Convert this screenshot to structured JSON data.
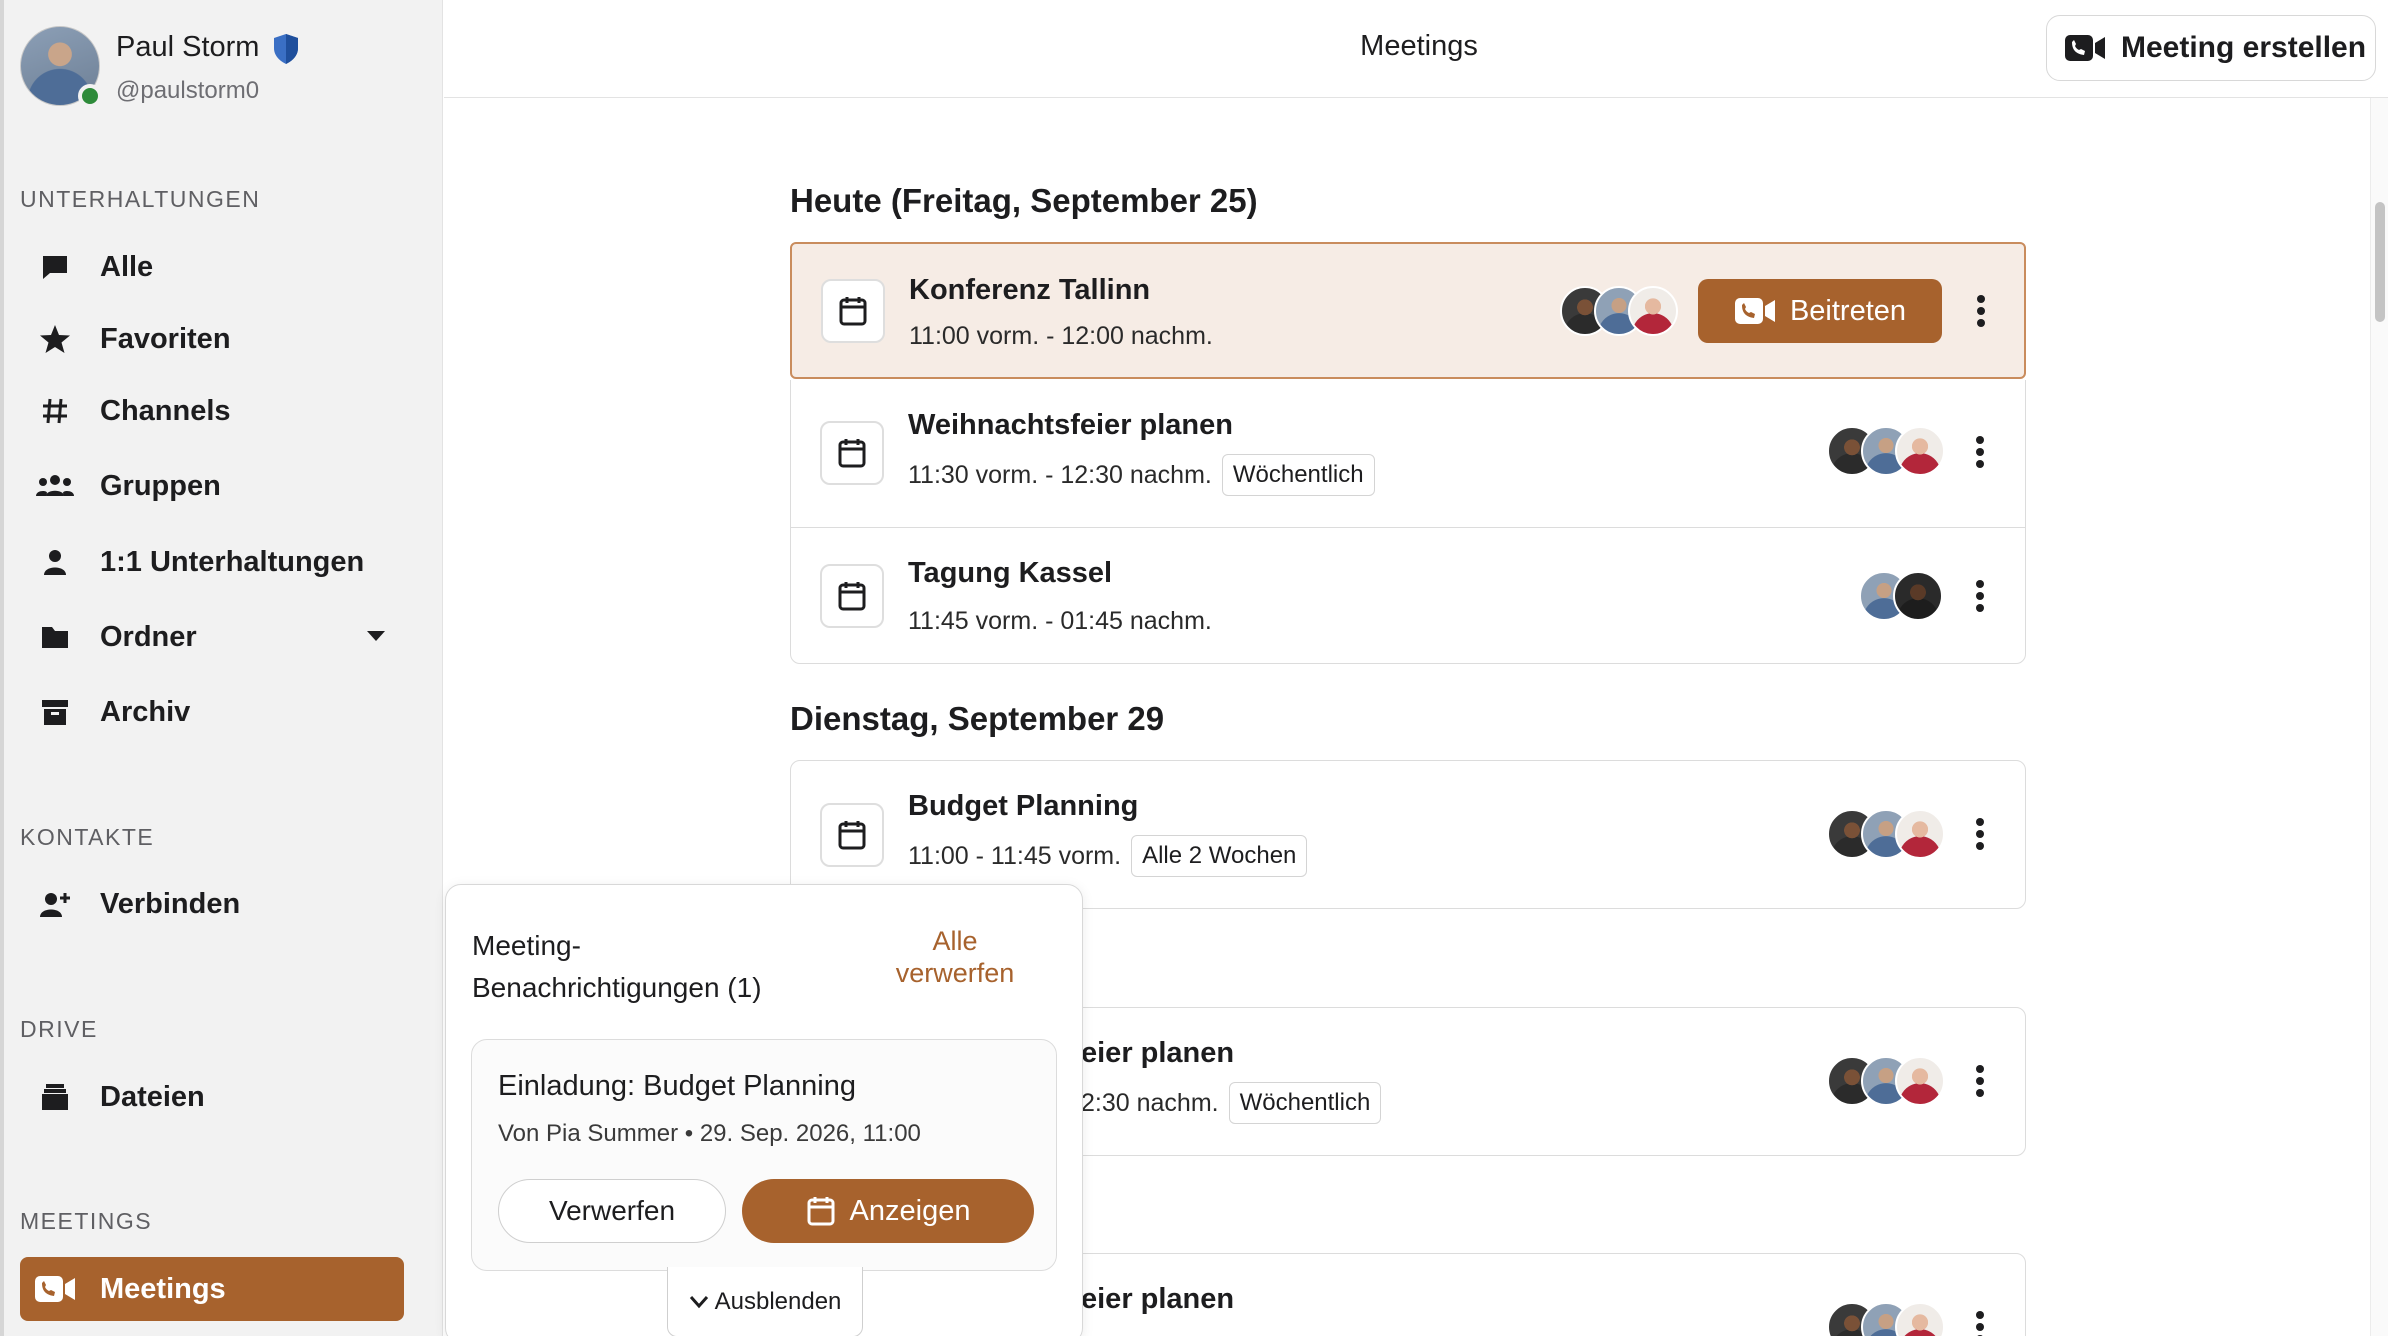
{
  "user": {
    "name": "Paul Storm",
    "handle": "@paulstorm0",
    "status": "online"
  },
  "sidebar": {
    "sections": {
      "conversations": "UNTERHALTUNGEN",
      "contacts": "KONTAKTE",
      "drive": "DRIVE",
      "meetings": "MEETINGS"
    },
    "items": [
      {
        "label": "Alle",
        "icon": "chat-bubble-icon"
      },
      {
        "label": "Favoriten",
        "icon": "star-icon"
      },
      {
        "label": "Channels",
        "icon": "hash-icon"
      },
      {
        "label": "Gruppen",
        "icon": "group-icon"
      },
      {
        "label": "1:1 Unterhaltungen",
        "icon": "person-icon"
      },
      {
        "label": "Ordner",
        "icon": "folder-icon"
      },
      {
        "label": "Archiv",
        "icon": "archive-icon"
      },
      {
        "label": "Verbinden",
        "icon": "add-person-icon"
      },
      {
        "label": "Dateien",
        "icon": "files-icon"
      },
      {
        "label": "Meetings",
        "icon": "video-call-icon",
        "active": true
      }
    ]
  },
  "header": {
    "title": "Meetings",
    "create_label": "Meeting erstellen"
  },
  "days": [
    {
      "heading": "Heute (Freitag, September 25)",
      "meetings": [
        {
          "title": "Konferenz Tallinn",
          "time": "11:00 vorm. - 12:00 nachm.",
          "recurrence": "",
          "join_label": "Beitreten",
          "highlight": true
        },
        {
          "title": "Weihnachtsfeier planen",
          "time": "11:30 vorm. - 12:30 nachm.",
          "recurrence": "Wöchentlich"
        },
        {
          "title": "Tagung Kassel",
          "time": "11:45 vorm. - 01:45 nachm.",
          "recurrence": ""
        }
      ]
    },
    {
      "heading": "Dienstag, September 29",
      "meetings": [
        {
          "title": "Budget Planning",
          "time": "11:00 - 11:45 vorm.",
          "recurrence": "Alle 2 Wochen"
        },
        {
          "title": "eier planen",
          "time": "2:30 nachm.",
          "recurrence": "Wöchentlich"
        },
        {
          "title": "eier planen",
          "time": "",
          "recurrence": ""
        }
      ]
    }
  ],
  "notifications": {
    "title": "Meeting-Benachrichtigungen (1)",
    "title_line1": "Meeting-",
    "title_line2": "Benachrichtigungen (1)",
    "dismiss_all_line1": "Alle",
    "dismiss_all_line2": "verwerfen",
    "invite": {
      "title": "Einladung: Budget Planning",
      "subtitle": "Von Pia Summer • 29. Sep. 2026, 11:00",
      "reject_label": "Verwerfen",
      "view_label": "Anzeigen"
    },
    "collapse_label": "Ausblenden"
  },
  "colors": {
    "accent": "#a7622d",
    "highlight_bg": "#f6ece5",
    "online": "#2e8b3a",
    "shield": "#3a6fc4"
  }
}
